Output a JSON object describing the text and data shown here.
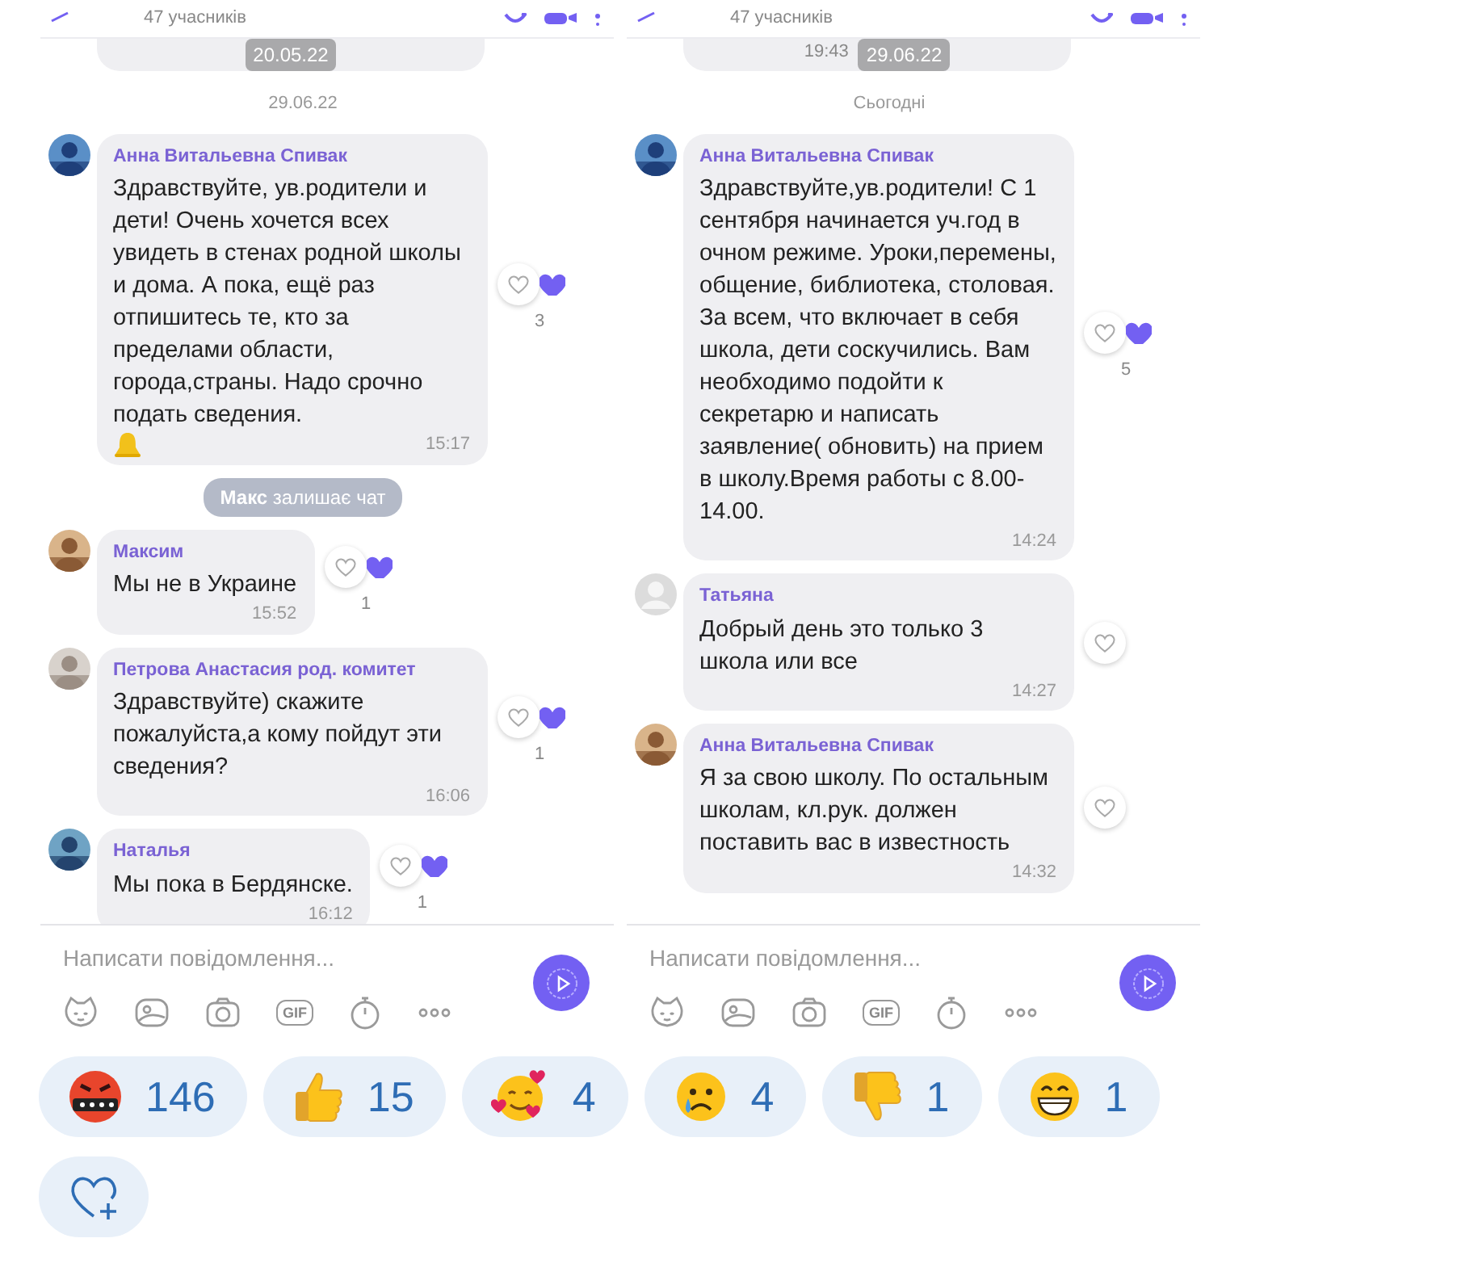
{
  "panels": [
    {
      "header": {
        "subtitle": "47 учасників"
      },
      "previous": {
        "date_chip": "20.05.22"
      },
      "items": [
        {
          "kind": "date",
          "text": "29.06.22"
        },
        {
          "kind": "message",
          "sender": "Анна Витальевна Спивак",
          "text": "Здравствуйте, ув.родители и дети! Очень хочется всех увидеть в стенах родной школы и дома. А пока, ещё раз отпишитесь те, кто за пределами области, города,страны. Надо срочно подать сведения.",
          "bell": true,
          "time": "15:17",
          "likes": "3"
        },
        {
          "kind": "system",
          "actor": "Макс",
          "text": "залишає чат"
        },
        {
          "kind": "message",
          "sender": "Максим",
          "text": "Мы не в Украине",
          "bell": false,
          "time": "15:52",
          "likes": "1"
        },
        {
          "kind": "message",
          "sender": "Петрова Анастасия род. комитет",
          "text": "Здравствуйте) скажите пожалуйста,а кому пойдут эти сведения?",
          "bell": false,
          "time": "16:06",
          "likes": "1"
        },
        {
          "kind": "message",
          "sender": "Наталья",
          "text": "Мы пока в Бердянске.",
          "bell": false,
          "time": "16:12",
          "likes": "1"
        }
      ],
      "composer": {
        "placeholder": "Написати повідомлення...",
        "gif_label": "GIF"
      }
    },
    {
      "header": {
        "subtitle": "47 учасників"
      },
      "previous": {
        "time": "19:43",
        "date_chip": "29.06.22"
      },
      "items": [
        {
          "kind": "date",
          "text": "Сьогодні"
        },
        {
          "kind": "message",
          "sender": "Анна Витальевна Спивак",
          "text": "Здравствуйте,ув.родители! С 1 сентября начинается уч.год в очном режиме. Уроки,перемены, общение, библиотека, столовая. За всем, что включает в себя школа, дети соскучились. Вам необходимо подойти к секретарю и написать заявление( обновить) на прием в школу.Время работы с 8.00-14.00.",
          "bell": false,
          "time": "14:24",
          "likes": "5"
        },
        {
          "kind": "message",
          "avatar": {
            "kind": "placeholder"
          },
          "sender": "Татьяна",
          "text": "Добрый день это только 3 школа или все",
          "bell": false,
          "time": "14:27"
        },
        {
          "kind": "message",
          "sender": "Анна Витальевна Спивак",
          "text": "Я за свою школу. По остальным школам, кл.рук. должен поставить вас в известность",
          "bell": false,
          "time": "14:32"
        }
      ],
      "composer": {
        "placeholder": "Написати повідомлення...",
        "gif_label": "GIF"
      }
    }
  ],
  "reactions": [
    {
      "kind": "angry",
      "count": "146"
    },
    {
      "kind": "thumbs_up",
      "count": "15"
    },
    {
      "kind": "hearts_face",
      "count": "4"
    },
    {
      "kind": "crying",
      "count": "4"
    },
    {
      "kind": "thumbs_down",
      "count": "1"
    },
    {
      "kind": "grin",
      "count": "1"
    },
    {
      "kind": "add"
    }
  ]
}
